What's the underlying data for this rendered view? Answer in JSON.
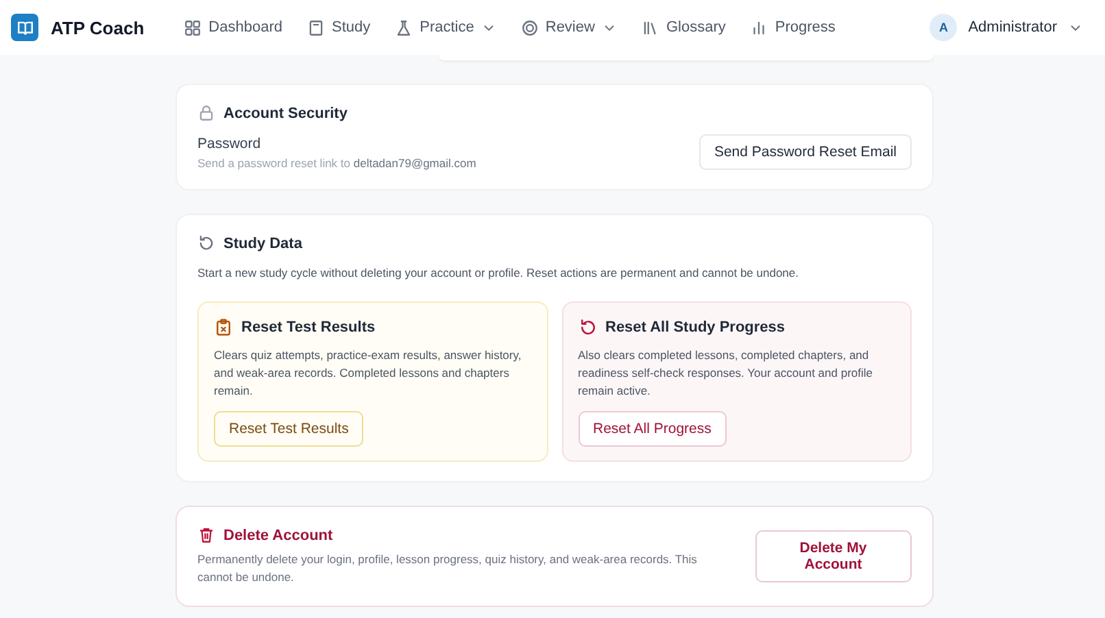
{
  "brand": {
    "name": "ATP Coach"
  },
  "nav": [
    {
      "label": "Dashboard",
      "dropdown": false
    },
    {
      "label": "Study",
      "dropdown": false
    },
    {
      "label": "Practice",
      "dropdown": true
    },
    {
      "label": "Review",
      "dropdown": true
    },
    {
      "label": "Glossary",
      "dropdown": false
    },
    {
      "label": "Progress",
      "dropdown": false
    }
  ],
  "user": {
    "initial": "A",
    "name": "Administrator"
  },
  "account_security": {
    "title": "Account Security",
    "label": "Password",
    "hint": "Send a password reset link to **deltadan79@gmail.com**",
    "button": "Send Password Reset Email"
  },
  "study_data": {
    "title": "Study Data",
    "description": "Start a new study cycle without deleting your account or profile. Reset actions are permanent and cannot be undone.",
    "options": [
      {
        "kind": "warning",
        "title": "Reset Test Results",
        "description": "Clears quiz attempts, practice-exam results, answer history, and weak-area records. Completed lessons and chapters remain.",
        "button": "Reset Test Results"
      },
      {
        "kind": "danger",
        "title": "Reset All Study Progress",
        "description": "Also clears completed lessons, completed chapters, and readiness self-check responses. Your account and profile remain active.",
        "button": "Reset All Progress"
      }
    ]
  },
  "delete_account": {
    "title": "Delete Account",
    "description": "Permanently delete your login, profile, lesson progress, quiz history, and weak-area records. This cannot be undone.",
    "button": "Delete My Account"
  }
}
